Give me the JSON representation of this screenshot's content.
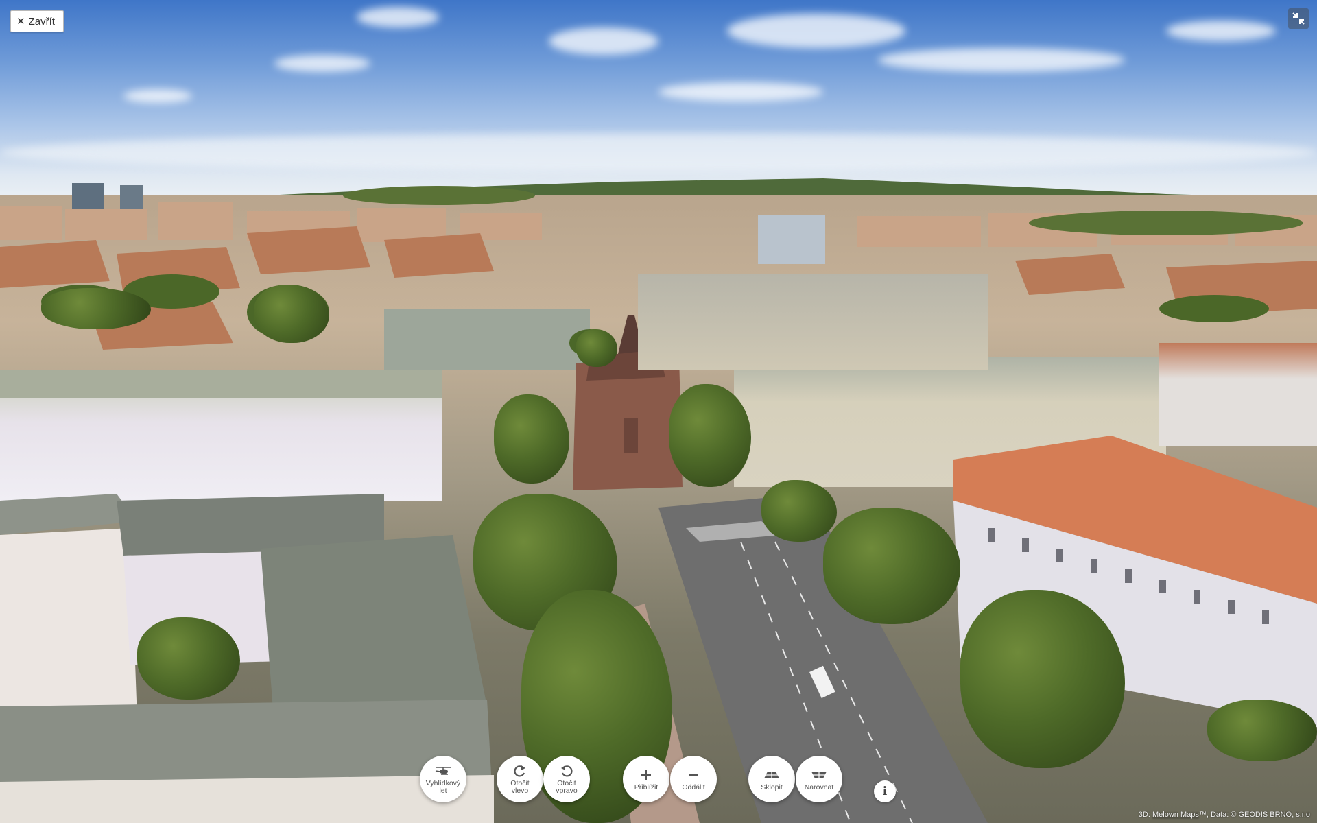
{
  "topbar": {
    "close_label": "Zavřít",
    "close_icon": "close-icon",
    "fullscreen_icon": "exit-fullscreen-icon"
  },
  "controls": [
    {
      "id": "flyover",
      "label": "Vyhlídkový\nlet",
      "icon": "helicopter-icon"
    },
    {
      "id": "rotate-left",
      "label": "Otočit\nvlevo",
      "icon": "rotate-left-icon"
    },
    {
      "id": "rotate-right",
      "label": "Otočit\nvpravo",
      "icon": "rotate-right-icon"
    },
    {
      "id": "zoom-in",
      "label": "Přiblížit",
      "icon": "plus-icon"
    },
    {
      "id": "zoom-out",
      "label": "Oddálit",
      "icon": "minus-icon"
    },
    {
      "id": "tilt",
      "label": "Sklopit",
      "icon": "tilt-icon"
    },
    {
      "id": "straighten",
      "label": "Narovnat",
      "icon": "straighten-icon"
    }
  ],
  "info": {
    "label": "i",
    "icon": "info-icon"
  },
  "attribution": {
    "prefix": "3D: ",
    "link": "Melown Maps",
    "suffix": "™, Data: © GEODIS BRNO, s.r.o"
  }
}
